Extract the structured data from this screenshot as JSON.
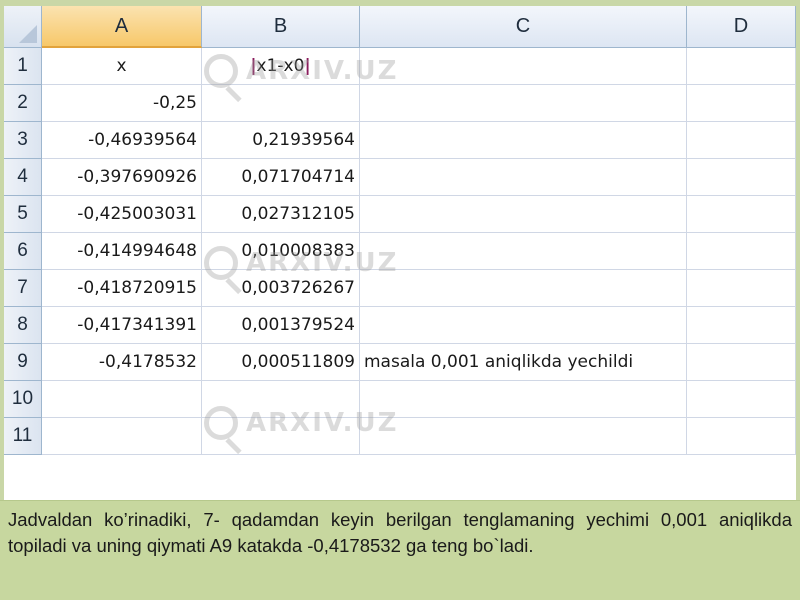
{
  "columns": [
    "A",
    "B",
    "C",
    "D"
  ],
  "rows": [
    {
      "num": "1",
      "a": "x",
      "b": "x1-x0",
      "c": ""
    },
    {
      "num": "2",
      "a": "-0,25",
      "b": "",
      "c": ""
    },
    {
      "num": "3",
      "a": "-0,46939564",
      "b": "0,21939564",
      "c": ""
    },
    {
      "num": "4",
      "a": "-0,397690926",
      "b": "0,071704714",
      "c": ""
    },
    {
      "num": "5",
      "a": "-0,425003031",
      "b": "0,027312105",
      "c": ""
    },
    {
      "num": "6",
      "a": "-0,414994648",
      "b": "0,010008383",
      "c": ""
    },
    {
      "num": "7",
      "a": "-0,418720915",
      "b": "0,003726267",
      "c": ""
    },
    {
      "num": "8",
      "a": "-0,417341391",
      "b": "0,001379524",
      "c": ""
    },
    {
      "num": "9",
      "a": "-0,4178532",
      "b": "0,000511809",
      "c": "masala 0,001 aniqlikda yechildi"
    },
    {
      "num": "10",
      "a": "",
      "b": "",
      "c": ""
    },
    {
      "num": "11",
      "a": "",
      "b": "",
      "c": ""
    }
  ],
  "abs_bar": "|",
  "watermark": "ARXIV.UZ",
  "caption": "Jadvaldan ko’rinadiki, 7- qadamdan keyin berilgan tenglamaning yechimi 0,001 aniqlikda topiladi va uning qiymati A9 katakda -0,4178532 ga teng bo`ladi."
}
